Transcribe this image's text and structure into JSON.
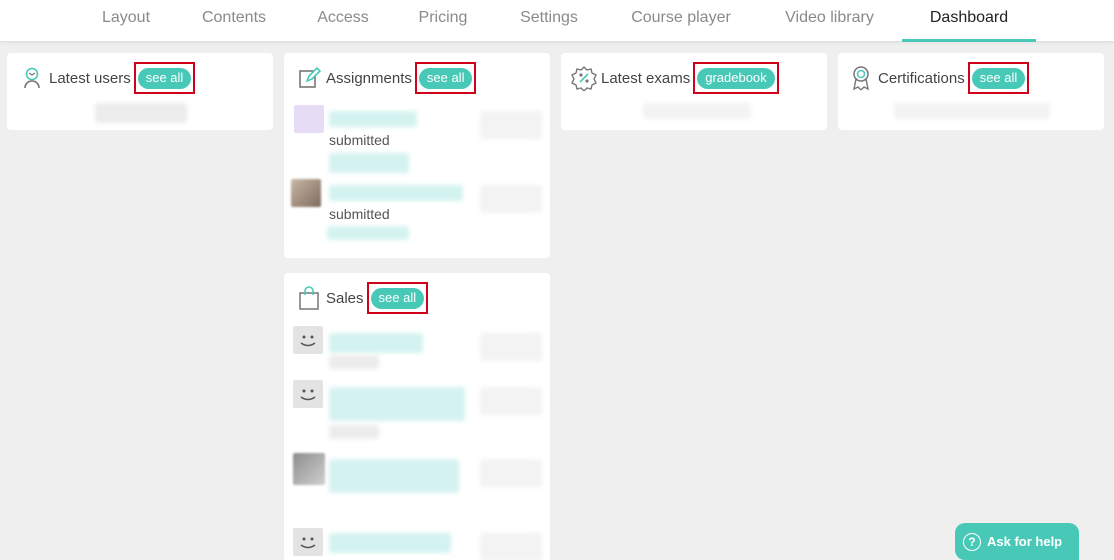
{
  "tabs": [
    {
      "label": "Layout"
    },
    {
      "label": "Contents"
    },
    {
      "label": "Access"
    },
    {
      "label": "Pricing"
    },
    {
      "label": "Settings"
    },
    {
      "label": "Course player"
    },
    {
      "label": "Video library"
    },
    {
      "label": "Dashboard",
      "active": true
    }
  ],
  "cards": {
    "latest_users": {
      "title": "Latest users",
      "action": "see all"
    },
    "assignments": {
      "title": "Assignments",
      "action": "see all",
      "status_1": "submitted",
      "status_2": "submitted"
    },
    "latest_exams": {
      "title": "Latest exams",
      "action": "gradebook"
    },
    "certifications": {
      "title": "Certifications",
      "action": "see all"
    },
    "sales": {
      "title": "Sales",
      "action": "see all"
    }
  },
  "help": {
    "label": "Ask for help",
    "icon": "?"
  },
  "colors": {
    "accent": "#48c9b7",
    "highlight_box": "#d0021b",
    "background": "#efefef"
  },
  "icons": [
    "user-icon",
    "edit-icon",
    "percent-badge-icon",
    "award-ribbon-icon",
    "shopping-bag-icon",
    "question-icon",
    "smiley-avatar-icon"
  ]
}
